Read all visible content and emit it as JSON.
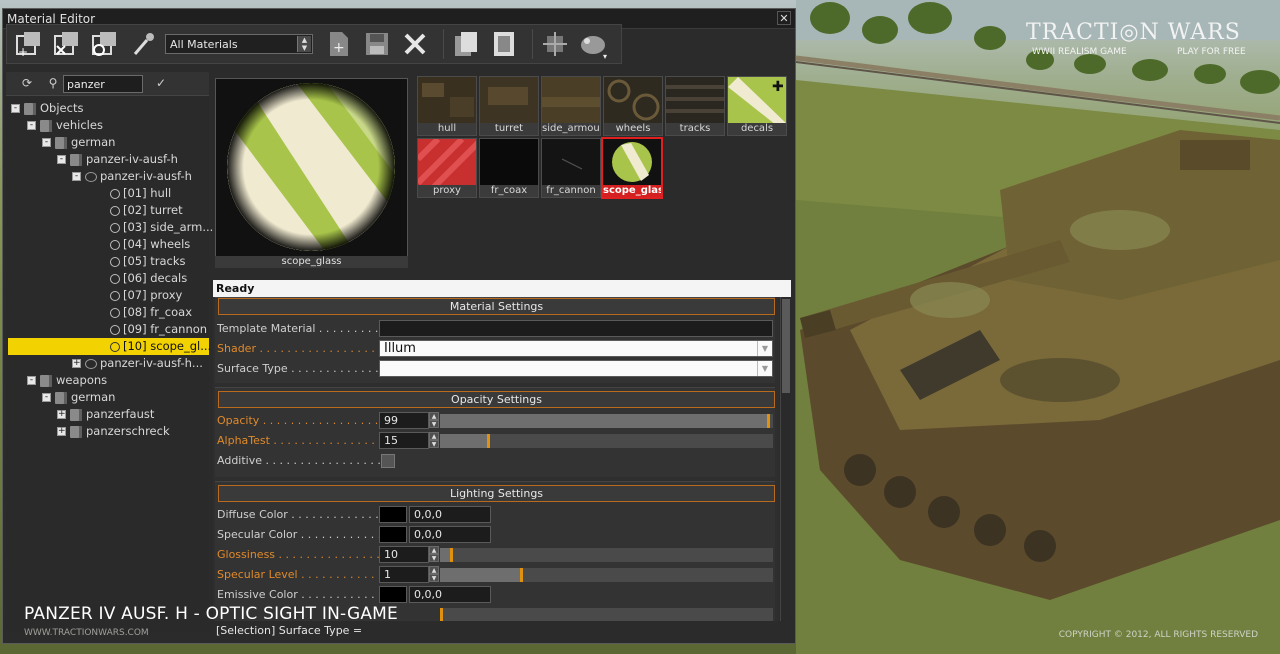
{
  "window": {
    "title": "Material Editor",
    "close_glyph": "✕"
  },
  "toolbar": {
    "icons": [
      "add-objects-icon",
      "remove-objects-icon",
      "refresh-objects-icon",
      "eyedropper-icon",
      "new-material-icon",
      "save-icon",
      "delete-icon",
      "copy-icon",
      "paste-icon",
      "preview-mesh-icon",
      "preview-options-icon"
    ],
    "filter_value": "All Materials"
  },
  "tree": {
    "search_value": "panzer",
    "apply_glyph": "✓",
    "nodes": [
      {
        "label": "Objects",
        "exp": "-"
      },
      {
        "label": "vehicles",
        "exp": "-"
      },
      {
        "label": "german",
        "exp": "-"
      },
      {
        "label": "panzer-iv-ausf-h",
        "exp": "-"
      },
      {
        "label": "panzer-iv-ausf-h",
        "exp": "-"
      },
      {
        "label": "[01] hull"
      },
      {
        "label": "[02] turret"
      },
      {
        "label": "[03] side_arm..."
      },
      {
        "label": "[04] wheels"
      },
      {
        "label": "[05] tracks"
      },
      {
        "label": "[06] decals"
      },
      {
        "label": "[07] proxy"
      },
      {
        "label": "[08] fr_coax"
      },
      {
        "label": "[09] fr_cannon"
      },
      {
        "label": "[10] scope_gl..."
      },
      {
        "label": "panzer-iv-ausf-h...",
        "exp": "+"
      },
      {
        "label": "weapons",
        "exp": "-"
      },
      {
        "label": "german",
        "exp": "-"
      },
      {
        "label": "panzerfaust",
        "exp": "+"
      },
      {
        "label": "panzerschreck",
        "exp": "+"
      }
    ]
  },
  "preview": {
    "label": "scope_glass"
  },
  "thumbnails": [
    {
      "label": "hull"
    },
    {
      "label": "turret"
    },
    {
      "label": "side_armour"
    },
    {
      "label": "wheels"
    },
    {
      "label": "tracks"
    },
    {
      "label": "decals"
    },
    {
      "label": "proxy"
    },
    {
      "label": "fr_coax"
    },
    {
      "label": "fr_cannon"
    },
    {
      "label": "scope_glass"
    }
  ],
  "status": "Ready",
  "material_settings": {
    "header": "Material Settings",
    "template_label": "Template Material . . . . . . . . . .",
    "template_value": "",
    "shader_label": "Shader . . . . . . . . . . . . . . . . . . . .",
    "shader_value": "Illum",
    "surface_label": "Surface Type . . . . . . . . . . . . .",
    "surface_value": ""
  },
  "opacity_settings": {
    "header": "Opacity Settings",
    "opacity_label": "Opacity . . . . . . . . . . . . . . . . . . . .",
    "opacity_value": "99",
    "opacity_level": 0.99,
    "alphatest_label": "AlphaTest . . . . . . . . . . . . . . . . .",
    "alphatest_value": "15",
    "alphatest_level": 0.15,
    "additive_label": "Additive . . . . . . . . . . . . . . . . . ."
  },
  "lighting_settings": {
    "header": "Lighting Settings",
    "diffuse_label": "Diffuse Color . . . . . . . . . . . . .",
    "diffuse_value": "0,0,0",
    "specular_label": "Specular Color . . . . . . . . . . . .",
    "specular_value": "0,0,0",
    "gloss_label": "Glossiness . . . . . . . . . . . . . . .",
    "gloss_value": "10",
    "gloss_level": 0.04,
    "speclevel_label": "Specular Level . . . . . . . . . . . .",
    "speclevel_value": "1",
    "speclevel_level": 0.25,
    "emissive_label": "Emissive Color . . . . . . . . . . . .",
    "emissive_value": "0,0,0"
  },
  "selection_status": "[Selection] Surface Type =",
  "branding": {
    "logo_big": "TRACTI◎N WARS",
    "logo_sub1": "WWII REALISM GAME",
    "logo_sub2": "PLAY FOR FREE",
    "copyright": "COPYRIGHT © 2012, ALL RIGHTS RESERVED",
    "caption": "PANZER IV AUSF. H - OPTIC SIGHT IN-GAME",
    "caption_url": "WWW.TRACTIONWARS.COM"
  },
  "colors": {
    "accent_orange": "#e08a2a",
    "selection_yellow": "#f2d200",
    "selected_thumb_red": "#d42020"
  }
}
